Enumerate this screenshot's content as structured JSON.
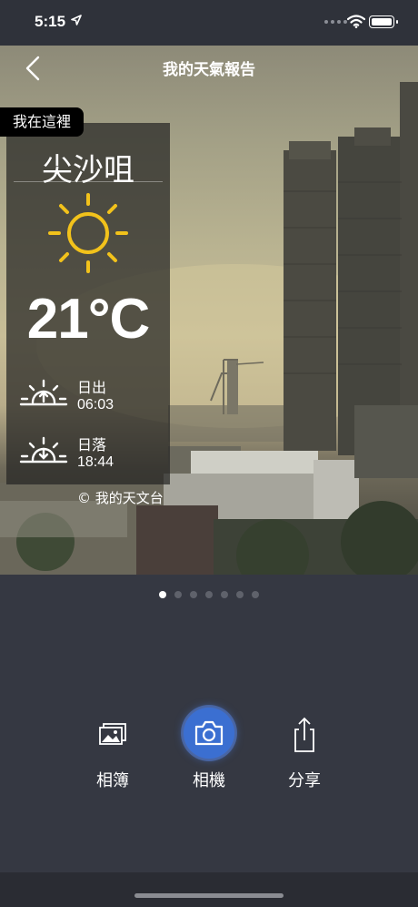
{
  "status_bar": {
    "time": "5:15"
  },
  "nav": {
    "title": "我的天氣報告"
  },
  "overlay": {
    "tag": "我在這裡",
    "district": "尖沙咀",
    "weather_icon": "sunny-icon",
    "temperature": "21°C",
    "sunrise": {
      "label": "日出",
      "time": "06:03"
    },
    "sunset": {
      "label": "日落",
      "time": "18:44"
    },
    "copyright": "© 我的天文台"
  },
  "pager": {
    "count": 7,
    "active_index": 0
  },
  "actions": {
    "album": "相簿",
    "camera": "相機",
    "share": "分享"
  },
  "colors": {
    "camera_accent": "#3b6fd1",
    "sun": "#f2c21b"
  }
}
